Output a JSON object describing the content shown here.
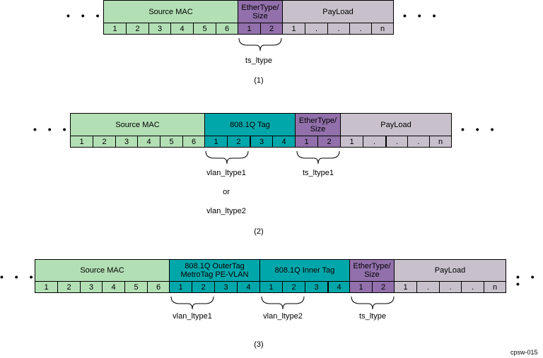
{
  "figure_id": "cpsw-015",
  "ellipsis": "• • •",
  "colors": {
    "source_mac": "#b3dfb5",
    "vlan_tag": "#00a7aa",
    "ethertype": "#9270ab",
    "payload": "#c8c1cb"
  },
  "diagrams": [
    {
      "caption": "(1)",
      "fields": [
        {
          "name": "Source MAC",
          "bytes": [
            "1",
            "2",
            "3",
            "4",
            "5",
            "6"
          ]
        },
        {
          "name": "EtherType/ Size",
          "bytes": [
            "1",
            "2"
          ]
        },
        {
          "name": "PayLoad",
          "bytes": [
            "1",
            ".",
            ".",
            ".",
            "n"
          ]
        }
      ],
      "annotations": [
        {
          "label": "ts_ltype"
        }
      ]
    },
    {
      "caption": "(2)",
      "fields": [
        {
          "name": "Source MAC",
          "bytes": [
            "1",
            "2",
            "3",
            "4",
            "5",
            "6"
          ]
        },
        {
          "name": "808.1Q Tag",
          "bytes": [
            "1",
            "2",
            "3",
            "4"
          ]
        },
        {
          "name": "EtherType/ Size",
          "bytes": [
            "1",
            "2"
          ]
        },
        {
          "name": "PayLoad",
          "bytes": [
            "1",
            ".",
            ".",
            ".",
            "n"
          ]
        }
      ],
      "annotations": [
        {
          "label": "vlan_ltype1",
          "or": "or",
          "alt": "vlan_ltype2"
        },
        {
          "label": "ts_ltype1"
        }
      ]
    },
    {
      "caption": "(3)",
      "fields": [
        {
          "name": "Source MAC",
          "bytes": [
            "1",
            "2",
            "3",
            "4",
            "5",
            "6"
          ]
        },
        {
          "name": "808.1Q OuterTag MetroTag PE-VLAN",
          "line1": "808.1Q OuterTag",
          "line2": "MetroTag PE-VLAN",
          "bytes": [
            "1",
            "2",
            "3",
            "4"
          ]
        },
        {
          "name": "808.1Q Inner Tag",
          "bytes": [
            "1",
            "2",
            "3",
            "4"
          ]
        },
        {
          "name": "EtherType/ Size",
          "bytes": [
            "1",
            "2"
          ]
        },
        {
          "name": "PayLoad",
          "bytes": [
            "1",
            ".",
            ".",
            ".",
            "n"
          ]
        }
      ],
      "annotations": [
        {
          "label": "vlan_ltype1"
        },
        {
          "label": "vlan_ltype2"
        },
        {
          "label": "ts_ltype"
        }
      ]
    }
  ]
}
